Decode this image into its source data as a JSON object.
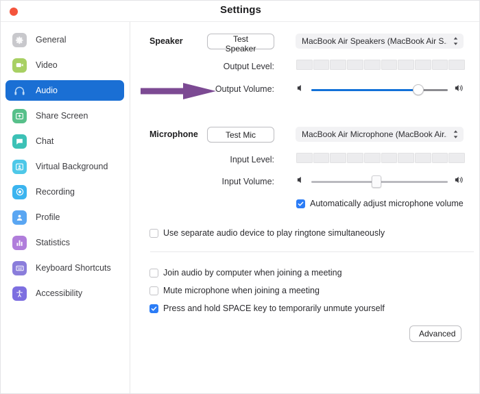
{
  "window": {
    "title": "Settings",
    "close_button": "close",
    "accent_blue": "#1a6fd4",
    "checkbox_blue": "#2b7cf6",
    "slider_fill": "#1271d8",
    "annotation_arrow_color": "#7c4a93"
  },
  "sidebar": {
    "items": [
      {
        "label": "General",
        "icon": "gear-icon",
        "color": "#c8c8cc",
        "selected": false
      },
      {
        "label": "Video",
        "icon": "camera-icon",
        "color": "#a8d063",
        "selected": false
      },
      {
        "label": "Audio",
        "icon": "headphones-icon",
        "color": "#1a6fd4",
        "selected": true
      },
      {
        "label": "Share Screen",
        "icon": "share-screen-icon",
        "color": "#57c08a",
        "selected": false
      },
      {
        "label": "Chat",
        "icon": "chat-bubble-icon",
        "color": "#3cc1b6",
        "selected": false
      },
      {
        "label": "Virtual Background",
        "icon": "virtual-background-icon",
        "color": "#4ec8e8",
        "selected": false
      },
      {
        "label": "Recording",
        "icon": "record-circle-icon",
        "color": "#3bb4ef",
        "selected": false
      },
      {
        "label": "Profile",
        "icon": "person-icon",
        "color": "#5aa6f2",
        "selected": false
      },
      {
        "label": "Statistics",
        "icon": "bar-chart-icon",
        "color": "#b07ddb",
        "selected": false
      },
      {
        "label": "Keyboard Shortcuts",
        "icon": "keyboard-icon",
        "color": "#8a7ddb",
        "selected": false
      },
      {
        "label": "Accessibility",
        "icon": "accessibility-icon",
        "color": "#7d6fe0",
        "selected": false
      }
    ]
  },
  "speaker": {
    "section_label": "Speaker",
    "test_button": "Test Speaker",
    "device": "MacBook Air Speakers (MacBook Air S...",
    "output_level_label": "Output Level:",
    "output_level_segments": 10,
    "output_level_active": 0,
    "output_volume_label": "Output Volume:",
    "output_volume_percent": 78
  },
  "microphone": {
    "section_label": "Microphone",
    "test_button": "Test Mic",
    "device": "MacBook Air Microphone (MacBook Air...",
    "input_level_label": "Input Level:",
    "input_level_segments": 10,
    "input_level_active": 0,
    "input_volume_label": "Input Volume:",
    "input_volume_percent": 47,
    "auto_adjust_label": "Automatically adjust microphone volume",
    "auto_adjust_checked": true
  },
  "options": {
    "separate_ringtone": {
      "label": "Use separate audio device to play ringtone simultaneously",
      "checked": false
    },
    "join_audio": {
      "label": "Join audio by computer when joining a meeting",
      "checked": false
    },
    "mute_on_join": {
      "label": "Mute microphone when joining a meeting",
      "checked": false
    },
    "space_unmute": {
      "label": "Press and hold SPACE key to temporarily unmute yourself",
      "checked": true
    }
  },
  "footer": {
    "advanced_button": "Advanced"
  }
}
